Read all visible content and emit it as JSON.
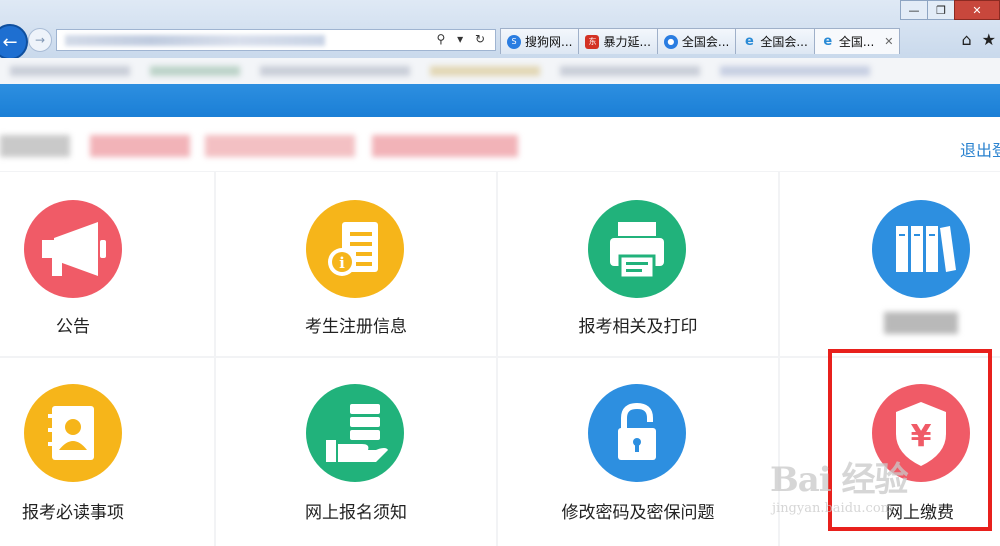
{
  "browser": {
    "tabs": [
      {
        "label": "搜狗网...",
        "icon": "sogou-icon",
        "color": "#2a7de1"
      },
      {
        "label": "暴力延...",
        "icon": "dongfang-icon",
        "color": "#d33224"
      },
      {
        "label": "全国会...",
        "icon": "baidu-paw-icon",
        "color": "#2a7de1"
      },
      {
        "label": "全国会...",
        "icon": "ie-icon",
        "color": "#2a8bd6"
      },
      {
        "label": "全国...",
        "icon": "ie-icon",
        "color": "#2a8bd6"
      }
    ],
    "tab_close": "✕",
    "address_icons": "⚲ ▾ ↻",
    "window_controls": [
      "—",
      "❐",
      "✕"
    ],
    "toolbar_icons": {
      "home": "⌂",
      "favorites": "★"
    }
  },
  "header": {
    "logout_label": "退出登"
  },
  "tiles": [
    {
      "label": "公告",
      "icon": "megaphone-icon",
      "color": "#f05b67"
    },
    {
      "label": "考生注册信息",
      "icon": "info-document-icon",
      "color": "#f6b51a"
    },
    {
      "label": "报考相关及打印",
      "icon": "printer-icon",
      "color": "#21b27b"
    },
    {
      "label": "",
      "icon": "book-binders-icon",
      "color": "#2d8fe0"
    },
    {
      "label": "报考必读事项",
      "icon": "contact-book-icon",
      "color": "#f6b51a"
    },
    {
      "label": "网上报名须知",
      "icon": "server-hand-icon",
      "color": "#21b27b"
    },
    {
      "label": "修改密码及密保问题",
      "icon": "padlock-icon",
      "color": "#2d8fe0"
    },
    {
      "label": "网上缴费",
      "icon": "yen-shield-icon",
      "color": "#f05b67"
    }
  ],
  "watermark": {
    "logo_text": "Bai 经验",
    "url_text": "jingyan.baidu.com"
  },
  "colors": {
    "highlight": "#e8201c",
    "blue_band": "#1b7fd6",
    "link": "#2a82cf"
  }
}
